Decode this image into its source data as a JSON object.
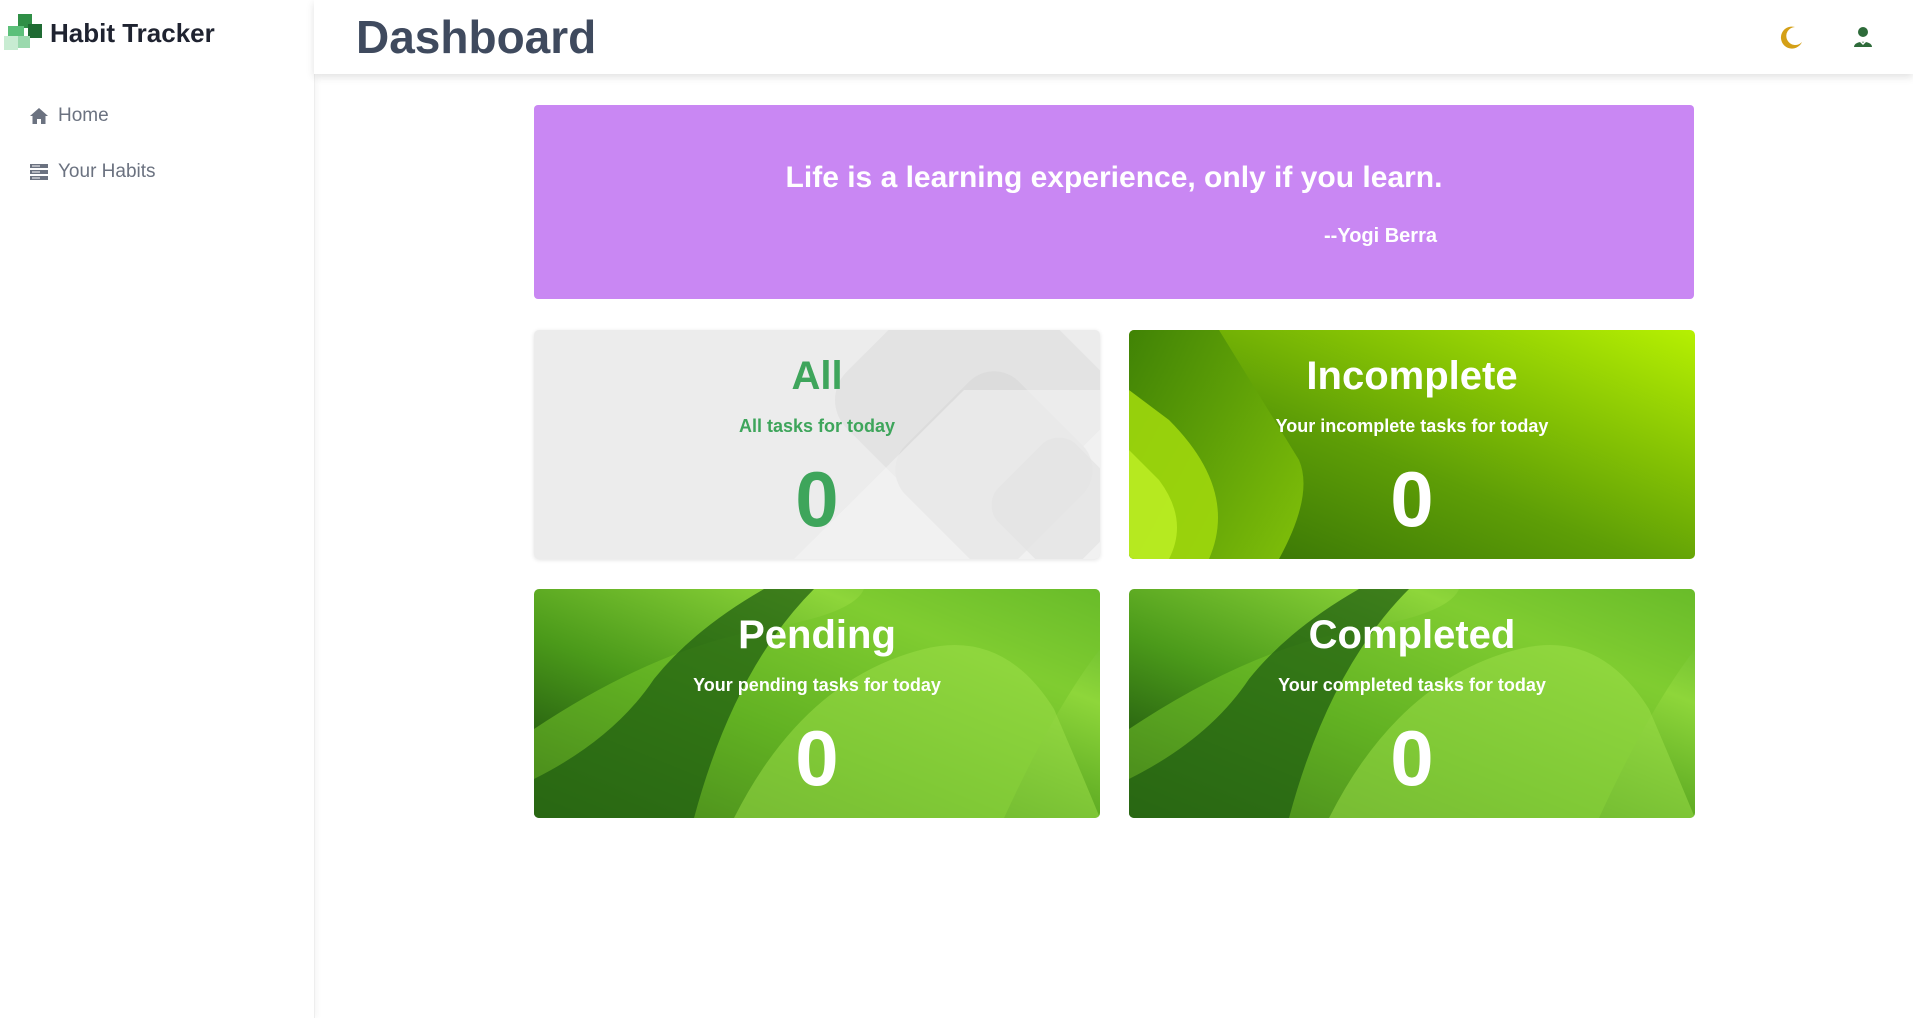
{
  "app": {
    "name": "Habit Tracker",
    "logo_icon": "habit-tracker-logo"
  },
  "sidebar": {
    "items": [
      {
        "label": "Home",
        "icon": "home-icon"
      },
      {
        "label": "Your Habits",
        "icon": "list-icon"
      }
    ]
  },
  "header": {
    "title": "Dashboard",
    "theme_icon": "moon-icon",
    "user_icon": "user-icon",
    "theme_color": "#d4a017",
    "user_color": "#2e6b3a"
  },
  "quote": {
    "text": "Life is a learning experience, only if you learn.",
    "author": "--Yogi Berra",
    "background": "#c987f3"
  },
  "cards": {
    "all": {
      "title": "All",
      "subtitle": "All tasks for today",
      "count": "0",
      "color": "#3ea55b"
    },
    "incomplete": {
      "title": "Incomplete",
      "subtitle": "Your incomplete tasks for today",
      "count": "0"
    },
    "pending": {
      "title": "Pending",
      "subtitle": "Your pending tasks for today",
      "count": "0"
    },
    "completed": {
      "title": "Completed",
      "subtitle": "Your completed tasks for today",
      "count": "0"
    }
  }
}
